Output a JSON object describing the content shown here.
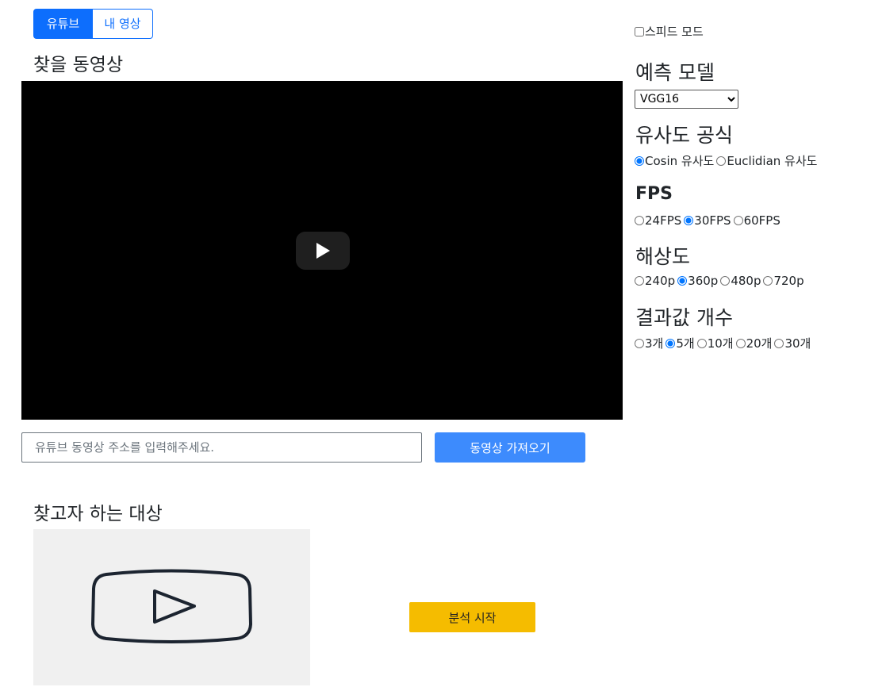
{
  "tabs": {
    "youtube": "유튜브",
    "my_video": "내 영상"
  },
  "video_section": {
    "title": "찾을 동영상"
  },
  "url": {
    "placeholder": "유튜브 동영상 주소를 입력해주세요.",
    "value": ""
  },
  "fetch_button": "동영상 가져오기",
  "target_section": {
    "title": "찾고자 하는 대상"
  },
  "analyze_button": "분석 시작",
  "speed_mode": {
    "label": "스피드 모드",
    "checked": false
  },
  "model": {
    "title": "예측 모델",
    "selected": "VGG16"
  },
  "similarity": {
    "title": "유사도 공식",
    "options": [
      {
        "label": "Cosin 유사도",
        "checked": true
      },
      {
        "label": "Euclidian 유사도",
        "checked": false
      }
    ]
  },
  "fps": {
    "title": "FPS",
    "options": [
      {
        "label": "24FPS",
        "checked": false
      },
      {
        "label": "30FPS",
        "checked": true
      },
      {
        "label": "60FPS",
        "checked": false
      }
    ]
  },
  "resolution": {
    "title": "해상도",
    "options": [
      {
        "label": "240p",
        "checked": false
      },
      {
        "label": "360p",
        "checked": true
      },
      {
        "label": "480p",
        "checked": false
      },
      {
        "label": "720p",
        "checked": false
      }
    ]
  },
  "result_count": {
    "title": "결과값 개수",
    "options": [
      {
        "label": "3개",
        "checked": false
      },
      {
        "label": "5개",
        "checked": true
      },
      {
        "label": "10개",
        "checked": false
      },
      {
        "label": "20개",
        "checked": false
      },
      {
        "label": "30개",
        "checked": false
      }
    ]
  },
  "icons": {
    "play": "play-icon",
    "video_placeholder": "video-placeholder-icon"
  },
  "colors": {
    "primary": "#0d6efd",
    "fetch_button": "#3d8bfd",
    "analyze_button": "#f5bc00",
    "player_bg": "#000000"
  }
}
